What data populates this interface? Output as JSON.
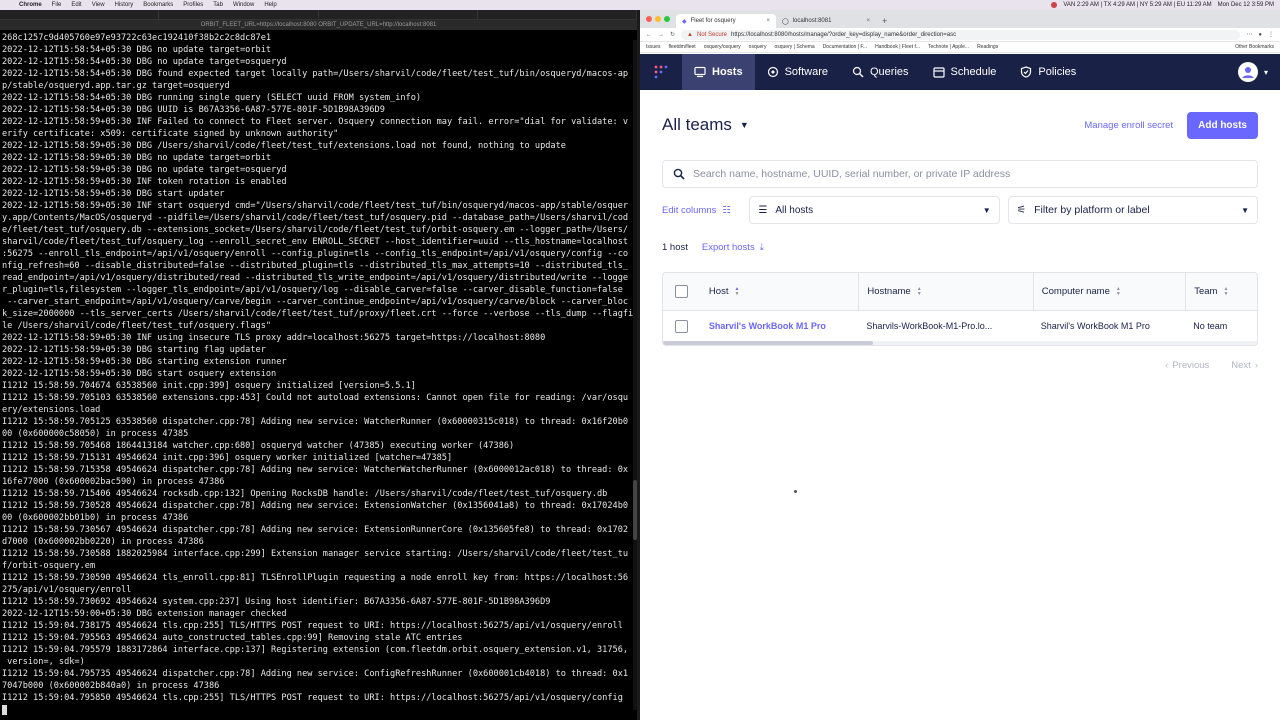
{
  "menubar": {
    "apple": "",
    "items": [
      "Chrome",
      "File",
      "Edit",
      "View",
      "History",
      "Bookmarks",
      "Profiles",
      "Tab",
      "Window",
      "Help"
    ],
    "status": "VAN 2:29 AM | TX 4:29 AM | NY 5:29 AM | EU 11:29 AM",
    "datetime": "Mon Dec 12  3:59 PM"
  },
  "terminal": {
    "tabs": [
      "",
      "",
      "",
      ""
    ],
    "title": "ORBIT_FLEET_URL=https://localhost:8080 ORBIT_UPDATE_URL=http://localhost:8081",
    "lines": [
      "268c1257c9d405760e97e93722c63ec192410f38b2c2c8dc87e1",
      "2022-12-12T15:58:54+05:30 DBG no update target=orbit",
      "2022-12-12T15:58:54+05:30 DBG no update target=osqueryd",
      "2022-12-12T15:58:54+05:30 DBG found expected target locally path=/Users/sharvil/code/fleet/test_tuf/bin/osqueryd/macos-ap",
      "p/stable/osqueryd.app.tar.gz target=osqueryd",
      "2022-12-12T15:58:54+05:30 DBG running single query (SELECT uuid FROM system_info)",
      "2022-12-12T15:58:54+05:30 DBG UUID is B67A3356-6A87-577E-801F-5D1B98A396D9",
      "2022-12-12T15:58:59+05:30 INF Failed to connect to Fleet server. Osquery connection may fail. error=\"dial for validate: v",
      "erify certificate: x509: certificate signed by unknown authority\"",
      "2022-12-12T15:58:59+05:30 DBG /Users/sharvil/code/fleet/test_tuf/extensions.load not found, nothing to update",
      "2022-12-12T15:58:59+05:30 DBG no update target=orbit",
      "2022-12-12T15:58:59+05:30 DBG no update target=osqueryd",
      "2022-12-12T15:58:59+05:30 INF token rotation is enabled",
      "2022-12-12T15:58:59+05:30 DBG start updater",
      "2022-12-12T15:58:59+05:30 INF start osqueryd cmd=\"/Users/sharvil/code/fleet/test_tuf/bin/osqueryd/macos-app/stable/osquer",
      "y.app/Contents/MacOS/osqueryd --pidfile=/Users/sharvil/code/fleet/test_tuf/osquery.pid --database_path=/Users/sharvil/cod",
      "e/fleet/test_tuf/osquery.db --extensions_socket=/Users/sharvil/code/fleet/test_tuf/orbit-osquery.em --logger_path=/Users/",
      "sharvil/code/fleet/test_tuf/osquery_log --enroll_secret_env ENROLL_SECRET --host_identifier=uuid --tls_hostname=localhost",
      ":56275 --enroll_tls_endpoint=/api/v1/osquery/enroll --config_plugin=tls --config_tls_endpoint=/api/v1/osquery/config --co",
      "nfig_refresh=60 --disable_distributed=false --distributed_plugin=tls --distributed_tls_max_attempts=10 --distributed_tls_",
      "read_endpoint=/api/v1/osquery/distributed/read --distributed_tls_write_endpoint=/api/v1/osquery/distributed/write --logge",
      "r_plugin=tls,filesystem --logger_tls_endpoint=/api/v1/osquery/log --disable_carver=false --carver_disable_function=false",
      " --carver_start_endpoint=/api/v1/osquery/carve/begin --carver_continue_endpoint=/api/v1/osquery/carve/block --carver_bloc",
      "k_size=2000000 --tls_server_certs /Users/sharvil/code/fleet/test_tuf/proxy/fleet.crt --force --verbose --tls_dump --flagfi",
      "le /Users/sharvil/code/fleet/test_tuf/osquery.flags\"",
      "2022-12-12T15:58:59+05:30 INF using insecure TLS proxy addr=localhost:56275 target=https://localhost:8080",
      "2022-12-12T15:58:59+05:30 DBG starting flag updater",
      "2022-12-12T15:58:59+05:30 DBG starting extension runner",
      "2022-12-12T15:58:59+05:30 DBG start osquery extension",
      "I1212 15:58:59.704674 63538560 init.cpp:399] osquery initialized [version=5.5.1]",
      "I1212 15:58:59.705103 63538560 extensions.cpp:453] Could not autoload extensions: Cannot open file for reading: /var/osqu",
      "ery/extensions.load",
      "I1212 15:58:59.705125 63538560 dispatcher.cpp:78] Adding new service: WatcherRunner (0x60000315c018) to thread: 0x16f20b0",
      "00 (0x600000c58050) in process 47385",
      "I1212 15:58:59.705468 1864413184 watcher.cpp:680] osqueryd watcher (47385) executing worker (47386)",
      "I1212 15:58:59.715131 49546624 init.cpp:396] osquery worker initialized [watcher=47385]",
      "I1212 15:58:59.715358 49546624 dispatcher.cpp:78] Adding new service: WatcherWatcherRunner (0x6000012ac018) to thread: 0x",
      "16fe77000 (0x600002bac590) in process 47386",
      "I1212 15:58:59.715406 49546624 rocksdb.cpp:132] Opening RocksDB handle: /Users/sharvil/code/fleet/test_tuf/osquery.db",
      "I1212 15:58:59.730528 49546624 dispatcher.cpp:78] Adding new service: ExtensionWatcher (0x1356041a8) to thread: 0x17024b0",
      "00 (0x600002bb01b0) in process 47386",
      "I1212 15:58:59.730567 49546624 dispatcher.cpp:78] Adding new service: ExtensionRunnerCore (0x135605fe8) to thread: 0x1702",
      "d7000 (0x600002bb0220) in process 47386",
      "I1212 15:58:59.730588 1882025984 interface.cpp:299] Extension manager service starting: /Users/sharvil/code/fleet/test_tu",
      "f/orbit-osquery.em",
      "I1212 15:58:59.730590 49546624 tls_enroll.cpp:81] TLSEnrollPlugin requesting a node enroll key from: https://localhost:56",
      "275/api/v1/osquery/enroll",
      "I1212 15:58:59.730692 49546624 system.cpp:237] Using host identifier: B67A3356-6A87-577E-801F-5D1B98A396D9",
      "2022-12-12T15:59:00+05:30 DBG extension manager checked",
      "I1212 15:59:04.738175 49546624 tls.cpp:255] TLS/HTTPS POST request to URI: https://localhost:56275/api/v1/osquery/enroll",
      "I1212 15:59:04.795563 49546624 auto_constructed_tables.cpp:99] Removing stale ATC entries",
      "I1212 15:59:04.795579 1883172864 interface.cpp:137] Registering extension (com.fleetdm.orbit.osquery_extension.v1, 31756,",
      " version=, sdk=)",
      "I1212 15:59:04.795735 49546624 dispatcher.cpp:78] Adding new service: ConfigRefreshRunner (0x600001cb4018) to thread: 0x1",
      "7047b000 (0x600002b840a0) in process 47386",
      "I1212 15:59:04.795850 49546624 tls.cpp:255] TLS/HTTPS POST request to URI: https://localhost:56275/api/v1/osquery/config"
    ]
  },
  "browser": {
    "tabs": [
      {
        "label": "Fleet for osquery",
        "active": true
      },
      {
        "label": "localhost:8081",
        "active": false
      }
    ],
    "newtab": "+",
    "security": "Not Secure",
    "url": "https://localhost:8080/hosts/manage/?order_key=display_name&order_direction=asc",
    "bookmarks": [
      "Issues",
      "fleetdm/fleet",
      "osquery/osquery",
      "osquery",
      "osquery | Schema",
      "Documentation | F...",
      "Handbook | Fleet f...",
      "Technote | Apple...",
      "Readings",
      "Other Bookmarks"
    ]
  },
  "nav": {
    "items": [
      {
        "label": "Hosts",
        "icon": "hosts-icon",
        "active": true
      },
      {
        "label": "Software",
        "icon": "software-icon",
        "active": false
      },
      {
        "label": "Queries",
        "icon": "queries-icon",
        "active": false
      },
      {
        "label": "Schedule",
        "icon": "schedule-icon",
        "active": false
      },
      {
        "label": "Policies",
        "icon": "policies-icon",
        "active": false
      }
    ]
  },
  "page": {
    "teams_title": "All teams",
    "manage_enroll_secret": "Manage enroll secret",
    "add_hosts": "Add hosts",
    "search_placeholder": "Search name, hostname, UUID, serial number, or private IP address",
    "edit_columns": "Edit columns",
    "status_filter": "All hosts",
    "platform_filter": "Filter by platform or label",
    "host_count": "1 host",
    "export_hosts": "Export hosts",
    "columns": [
      "Host",
      "Hostname",
      "Computer name",
      "Team"
    ],
    "rows": [
      {
        "host": "Sharvil's WorkBook M1 Pro",
        "hostname": "Sharvils-WorkBook-M1-Pro.lo...",
        "computer_name": "Sharvil's WorkBook M1 Pro",
        "team": "No team"
      }
    ],
    "previous": "Previous",
    "next": "Next"
  },
  "colors": {
    "nav_bg": "#192147",
    "accent": "#6a67fe",
    "text": "#192147"
  }
}
